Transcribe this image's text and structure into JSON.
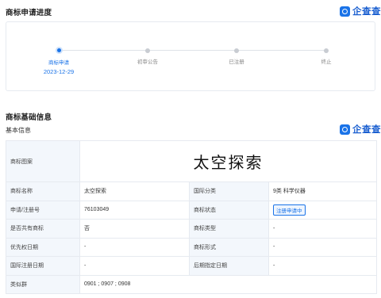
{
  "progress": {
    "title": "商标申请进度",
    "brand": "企查查",
    "steps": [
      {
        "label": "商标申请",
        "date": "2023-12-29",
        "active": true
      },
      {
        "label": "初审公告",
        "date": "",
        "active": false
      },
      {
        "label": "已注册",
        "date": "",
        "active": false
      },
      {
        "label": "终止",
        "date": "",
        "active": false
      }
    ]
  },
  "basic": {
    "title": "商标基础信息",
    "subtitle": "基本信息",
    "brand": "企查查",
    "image_label": "商标图案",
    "image_text": "太空探索",
    "rows": [
      {
        "l1": "商标名称",
        "v1": "太空探索",
        "l2": "国际分类",
        "v2": "9类 科学仪器"
      },
      {
        "l1": "申请/注册号",
        "v1": "76103049",
        "l2": "商标状态",
        "v2": "注册申请中"
      },
      {
        "l1": "是否共有商标",
        "v1": "否",
        "l2": "商标类型",
        "v2": "-"
      },
      {
        "l1": "优先权日期",
        "v1": "-",
        "l2": "商标形式",
        "v2": "-"
      },
      {
        "l1": "国际注册日期",
        "v1": "-",
        "l2": "后期指定日期",
        "v2": "-"
      }
    ],
    "similar_label": "类似群",
    "similar_value": "0901 ; 0907 ; 0908"
  },
  "colors": {
    "accent": "#1a73e8",
    "label_bg": "#f3f7fc",
    "border": "#e6eaf0"
  }
}
